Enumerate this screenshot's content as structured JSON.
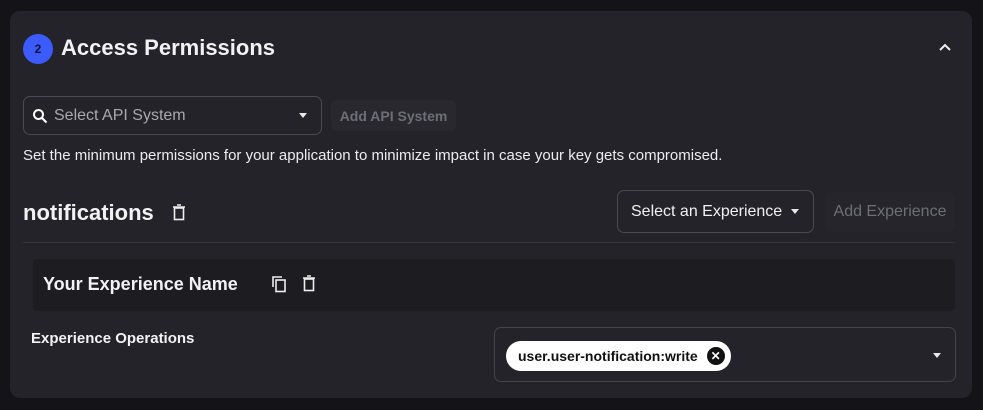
{
  "section": {
    "step_number": "2",
    "title": "Access Permissions"
  },
  "api_system": {
    "placeholder": "Select API System",
    "add_label": "Add API System"
  },
  "description": "Set the minimum permissions for your application to minimize impact in case your key gets compromised.",
  "api_group": {
    "name": "notifications",
    "experience_select": "Select an Experience",
    "add_experience_label": "Add Experience",
    "experience": {
      "name": "Your Experience Name",
      "operations_label": "Experience Operations",
      "operations": [
        "user.user-notification:write"
      ]
    }
  },
  "colors": {
    "accent": "#3b5bfc",
    "panel": "#232329",
    "background": "#141418"
  }
}
